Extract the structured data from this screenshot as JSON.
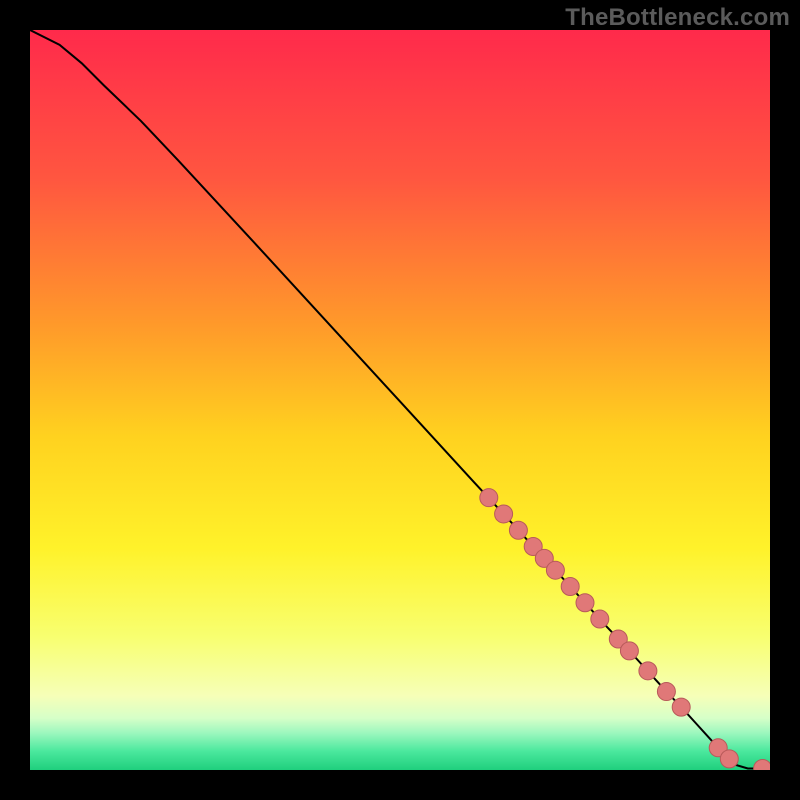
{
  "watermark": "TheBottleneck.com",
  "colors": {
    "dot": "#e07878",
    "dot_stroke": "#b85a5a",
    "curve": "#000000",
    "gradient_stops": [
      {
        "offset": 0.0,
        "color": "#ff2a4b"
      },
      {
        "offset": 0.2,
        "color": "#ff5640"
      },
      {
        "offset": 0.4,
        "color": "#ff9a2a"
      },
      {
        "offset": 0.55,
        "color": "#ffd21f"
      },
      {
        "offset": 0.7,
        "color": "#fff22a"
      },
      {
        "offset": 0.82,
        "color": "#f8ff70"
      },
      {
        "offset": 0.9,
        "color": "#f6ffb8"
      },
      {
        "offset": 0.93,
        "color": "#d6ffc8"
      },
      {
        "offset": 0.95,
        "color": "#9cf7be"
      },
      {
        "offset": 0.975,
        "color": "#4ae89d"
      },
      {
        "offset": 1.0,
        "color": "#1fcf7d"
      }
    ]
  },
  "chart_data": {
    "type": "line",
    "title": "",
    "xlabel": "",
    "ylabel": "",
    "xlim": [
      0,
      100
    ],
    "ylim": [
      0,
      100
    ],
    "x": [
      0,
      4,
      7,
      10,
      15,
      20,
      30,
      40,
      50,
      60,
      65,
      70,
      72,
      74,
      76,
      78,
      80,
      82,
      84,
      86,
      88,
      90,
      92,
      94,
      95,
      97,
      100
    ],
    "values": [
      100,
      98,
      95.5,
      92.5,
      87.7,
      82.4,
      71.6,
      60.7,
      49.8,
      38.9,
      33.5,
      28.0,
      25.9,
      23.7,
      21.5,
      19.3,
      17.2,
      15.0,
      12.8,
      10.6,
      8.5,
      6.3,
      4.1,
      1.9,
      0.8,
      0.2,
      0.2
    ],
    "markers": {
      "x": [
        62,
        64,
        66,
        68,
        69.5,
        71,
        73,
        75,
        77,
        79.5,
        81,
        83.5,
        86,
        88,
        93,
        94.5,
        99
      ],
      "y": [
        36.8,
        34.6,
        32.4,
        30.2,
        28.6,
        27.0,
        24.8,
        22.6,
        20.4,
        17.7,
        16.1,
        13.4,
        10.6,
        8.5,
        3.0,
        1.5,
        0.2
      ]
    }
  }
}
